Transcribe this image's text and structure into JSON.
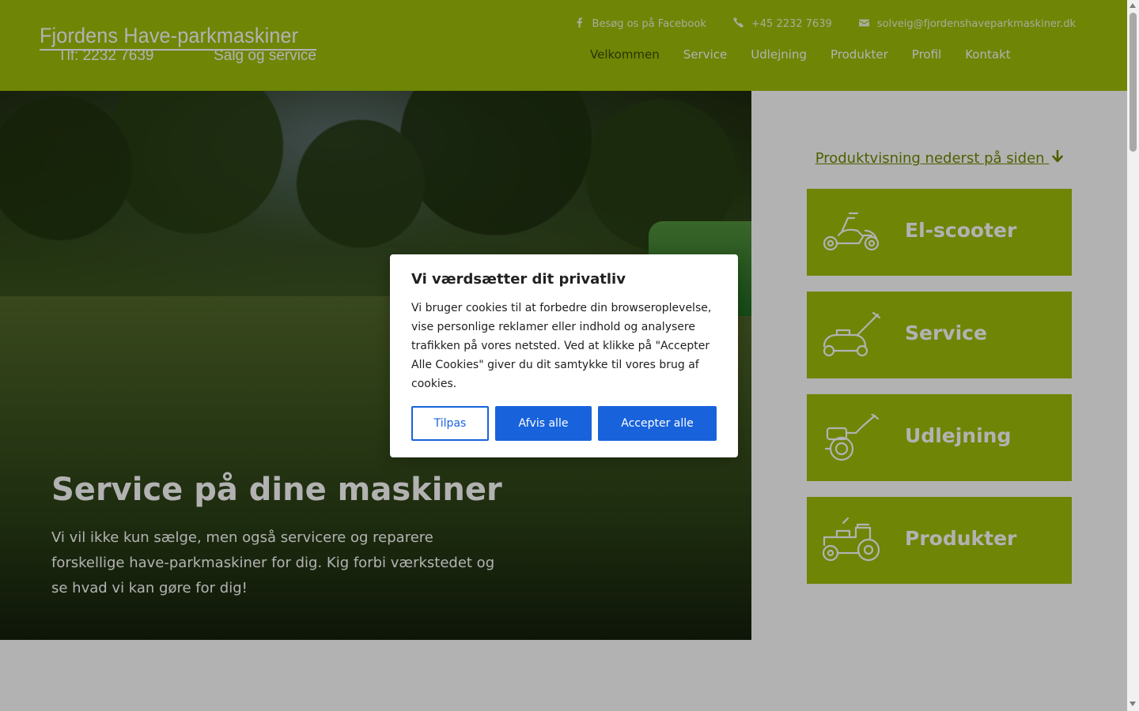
{
  "header": {
    "logo": {
      "line1": "Fjordens Have-parkmaskiner",
      "line2": "Tlf: 2232 7639",
      "line3": "Salg og service"
    },
    "topbar": {
      "facebook": "Besøg os på Facebook",
      "phone": "+45 2232 7639",
      "email": "solveig@fjordenshaveparkmaskiner.dk"
    },
    "nav": [
      "Velkommen",
      "Service",
      "Udlejning",
      "Produkter",
      "Profil",
      "Kontakt"
    ],
    "active_nav": "Velkommen"
  },
  "hero": {
    "title": "Service på dine maskiner",
    "text": "Vi vil ikke kun sælge, men også servicere og reparere forskellige have-parkmaskiner for dig. Kig forbi værkstedet og se hvad vi kan gøre for dig!"
  },
  "side": {
    "product_link": "Produktvisning nederst på siden",
    "tiles": [
      {
        "label": "El-scooter",
        "icon": "scooter-icon"
      },
      {
        "label": "Service",
        "icon": "lawn-mower-icon"
      },
      {
        "label": "Udlejning",
        "icon": "tiller-icon"
      },
      {
        "label": "Produkter",
        "icon": "tractor-icon"
      }
    ]
  },
  "cookie_modal": {
    "title": "Vi værdsætter dit privatliv",
    "text": "Vi bruger cookies til at forbedre din browseroplevelse, vise personlige reklamer eller indhold og analysere trafikken på vores netsted. Ved at klikke på \"Accepter Alle Cookies\" giver du dit samtykke til vores brug af cookies.",
    "customize_label": "Tilpas",
    "reject_label": "Afvis alle",
    "accept_label": "Accepter alle"
  },
  "colors": {
    "brand_green": "#9fbf0a",
    "button_blue": "#1863dc",
    "link_green": "#6f8a00"
  }
}
